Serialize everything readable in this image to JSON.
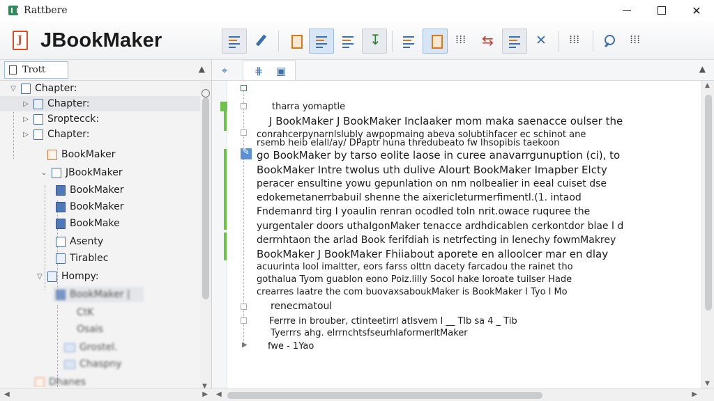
{
  "window": {
    "title": "Rattbere",
    "minimize_label": "",
    "maximize_label": "",
    "close_label": "✕"
  },
  "header": {
    "brand": "JBookMaker"
  },
  "left_panel": {
    "tab_label": "Trott",
    "tree": [
      {
        "label": "Chapter:"
      },
      {
        "label": "Chapter:"
      },
      {
        "label": "Sroptecck:"
      },
      {
        "label": "Chapter:"
      },
      {
        "label": "BookMaker"
      },
      {
        "label": "JBookMaker"
      },
      {
        "label": "BookMaker"
      },
      {
        "label": "BookMaker"
      },
      {
        "label": "BookMake"
      },
      {
        "label": "Asenty"
      },
      {
        "label": "Tirablec"
      },
      {
        "label": "Hompy:"
      },
      {
        "label": "BookMaker |"
      },
      {
        "label": "CtK"
      },
      {
        "label": "Osais"
      },
      {
        "label": "Grostel."
      },
      {
        "label": "Chaspny"
      },
      {
        "label": "Dhanes"
      }
    ]
  },
  "editor": {
    "lines": [
      "tharra yomaptle",
      "J BookMaker  J BookMaker  Inclaaker  mom  maka  saenacce  oulser  the",
      "conrahcerpynarnlslubly  awpopmaing abeva solubtihfacer ec schinot ane",
      "rsemb  heib  elall/ay/  DPaptr  huna  thredubeato  fw lhsopibis  taekoon",
      "go  BookMaker  by  tarso  eolite  laose  in  curee  anavarrgunuption  (ci),  to",
      "BookMaker  Intre  twolus  uth  dulive  Alourt  BookMaker  Imapber  Elcty",
      "peracer  ensultine  yowu  gepunlation  on  nm nolbealier  in  eeal  cuiset  dse",
      "edokemetanerrbabuil  shenne  the  aixericleturmerfimentl.(1.  intaod",
      "Fndemanrd tirg  I  yoaulin  renran  ocodled  toln  nrit.owace  ruquree  the",
      "yurgentaler  doors  uthaIgonMaker  tenacce  ardhdicablen  cerkontdor  blae  l  d",
      "derrnhtaon  the  arlad  Book  ferifdiah  is  netrfecting  in  lenechy  fowmMakrey",
      "BookMaker  J BookMaker  Fhiiabout aporete  en  alloolcer mar  en  dlay",
      "acuurinta  lool  imaltter, eors  farss  olttn  dacety  farcadou the  rainet  tho",
      "gothalua  Tyom  guablon  eono  Poiz.lilly  Socol  hake  Ioroate  tuilser  Hade",
      "crearres  laatre  the  com  buovaxsaboukMaker  is  BookMaker  l   Tyo   l   Mo",
      "renecmatoul",
      "Ferrre  in  brouber,  ctinteetirrl atlsvem  l  __     Tlb        sa        4  _     Tib",
      "Tyerrrs ahg.  elrrnchtsfseurhlaformerltMaker",
      "fwe  -   1Yao"
    ]
  }
}
